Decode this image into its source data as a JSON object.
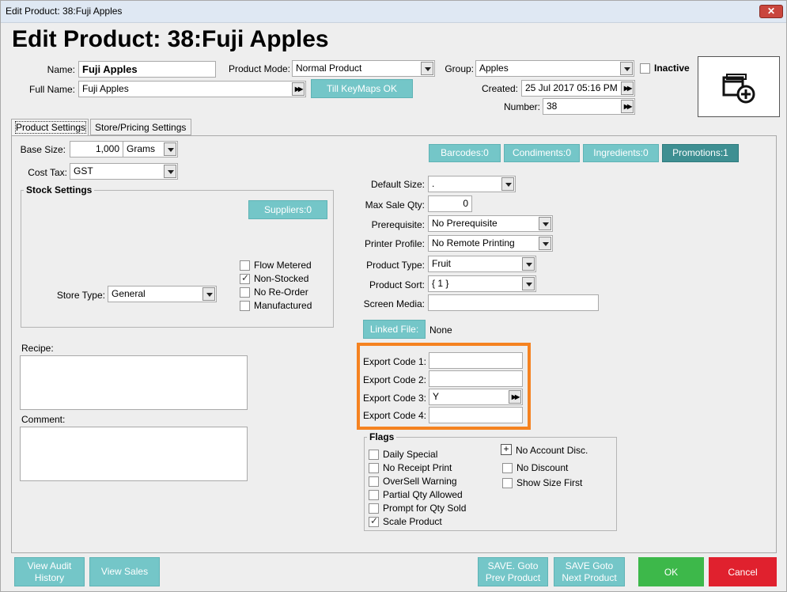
{
  "window": {
    "title": "Edit Product: 38:Fuji Apples",
    "close_label": "✕"
  },
  "header": {
    "title": "Edit Product: 38:Fuji Apples"
  },
  "top_fields": {
    "name_label": "Name:",
    "name_value": "Fuji Apples",
    "fullname_label": "Full Name:",
    "fullname_value": "Fuji Apples",
    "product_mode_label": "Product Mode:",
    "product_mode_value": "Normal Product",
    "till_keymaps_label": "Till KeyMaps OK",
    "group_label": "Group:",
    "group_value": "Apples",
    "inactive_label": "Inactive",
    "created_label": "Created:",
    "created_value": "25 Jul 2017 05:16 PM",
    "number_label": "Number:",
    "number_value": "38",
    "add_image_icon": "add-image-icon"
  },
  "tabs": [
    {
      "label": "Product Settings",
      "active": true
    },
    {
      "label": "Store/Pricing Settings",
      "active": false
    }
  ],
  "left": {
    "base_size_label": "Base Size:",
    "base_size_value": "1,000",
    "base_size_unit": "Grams",
    "cost_tax_label": "Cost Tax:",
    "cost_tax_value": "GST",
    "stock_settings_title": "Stock Settings",
    "suppliers_label": "Suppliers:0",
    "store_type_label": "Store Type:",
    "store_type_value": "General",
    "stock_flags": [
      {
        "label": "Flow Metered",
        "checked": false
      },
      {
        "label": "Non-Stocked",
        "checked": true
      },
      {
        "label": "No Re-Order",
        "checked": false
      },
      {
        "label": "Manufactured",
        "checked": false
      }
    ],
    "recipe_label": "Recipe:",
    "comment_label": "Comment:"
  },
  "right": {
    "tabs_buttons": [
      "Barcodes:0",
      "Condiments:0",
      "Ingredients:0",
      "Promotions:1"
    ],
    "default_size_label": "Default Size:",
    "default_size_value": ".",
    "max_sale_qty_label": "Max Sale Qty:",
    "max_sale_qty_value": "0",
    "prerequisite_label": "Prerequisite:",
    "prerequisite_value": "No Prerequisite",
    "printer_profile_label": "Printer Profile:",
    "printer_profile_value": "No Remote Printing",
    "product_type_label": "Product Type:",
    "product_type_value": "Fruit",
    "product_sort_label": "Product Sort:",
    "product_sort_value": "{ 1 }",
    "screen_media_label": "Screen Media:",
    "screen_media_value": "",
    "linked_file_label": "Linked File:",
    "linked_file_value": "None",
    "export_codes": [
      {
        "label": "Export Code 1:",
        "value": ""
      },
      {
        "label": "Export Code 2:",
        "value": ""
      },
      {
        "label": "Export Code 3:",
        "value": "Y"
      },
      {
        "label": "Export Code 4:",
        "value": ""
      }
    ],
    "flags_title": "Flags",
    "flags_left": [
      {
        "label": "Daily Special",
        "checked": false
      },
      {
        "label": "No Receipt Print",
        "checked": false
      },
      {
        "label": "OverSell Warning",
        "checked": false
      },
      {
        "label": "Partial Qty Allowed",
        "checked": false
      },
      {
        "label": "Prompt for Qty Sold",
        "checked": false
      },
      {
        "label": "Scale Product",
        "checked": true
      }
    ],
    "no_account_disc_label": "No Account Disc.",
    "flags_right": [
      {
        "label": "No Discount",
        "checked": false
      },
      {
        "label": "Show Size First",
        "checked": false
      }
    ]
  },
  "bottom": {
    "view_audit_label": "View Audit History",
    "view_sales_label": "View Sales",
    "save_prev_label": "SAVE. Goto Prev Product",
    "save_next_label": "SAVE Goto Next Product",
    "ok_label": "OK",
    "cancel_label": "Cancel"
  },
  "colors": {
    "accent_teal": "#74c6c8",
    "highlight_orange": "#f58220",
    "ok_green": "#3db84a",
    "cancel_red": "#e0212e"
  }
}
